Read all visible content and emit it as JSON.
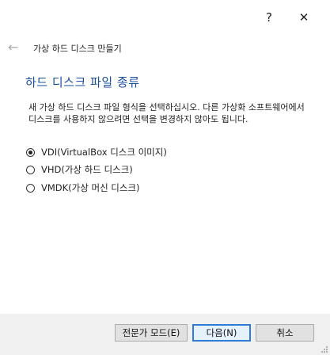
{
  "titlebar": {
    "help_label": "?",
    "close_label": "✕"
  },
  "header": {
    "back_icon": "back-arrow-icon",
    "title": "가상 하드 디스크 만들기"
  },
  "section": {
    "title": "하드 디스크 파일 종류"
  },
  "description": "새 가상 하드 디스크 파일 형식을 선택하십시오. 다른 가상화 소프트웨어에서 디스크를 사용하지 않으려면 선택을 변경하지 않아도 됩니다.",
  "options": [
    {
      "label": "VDI(VirtualBox 디스크 이미지)",
      "checked": true
    },
    {
      "label": "VHD(가상 하드 디스크)",
      "checked": false
    },
    {
      "label": "VMDK(가상 머신 디스크)",
      "checked": false
    }
  ],
  "buttons": {
    "expert": "전문가 모드(E)",
    "next": "다음(N)",
    "cancel": "취소"
  },
  "colors": {
    "accent": "#1a4f9c",
    "default_button_border": "#2e7bd8"
  }
}
